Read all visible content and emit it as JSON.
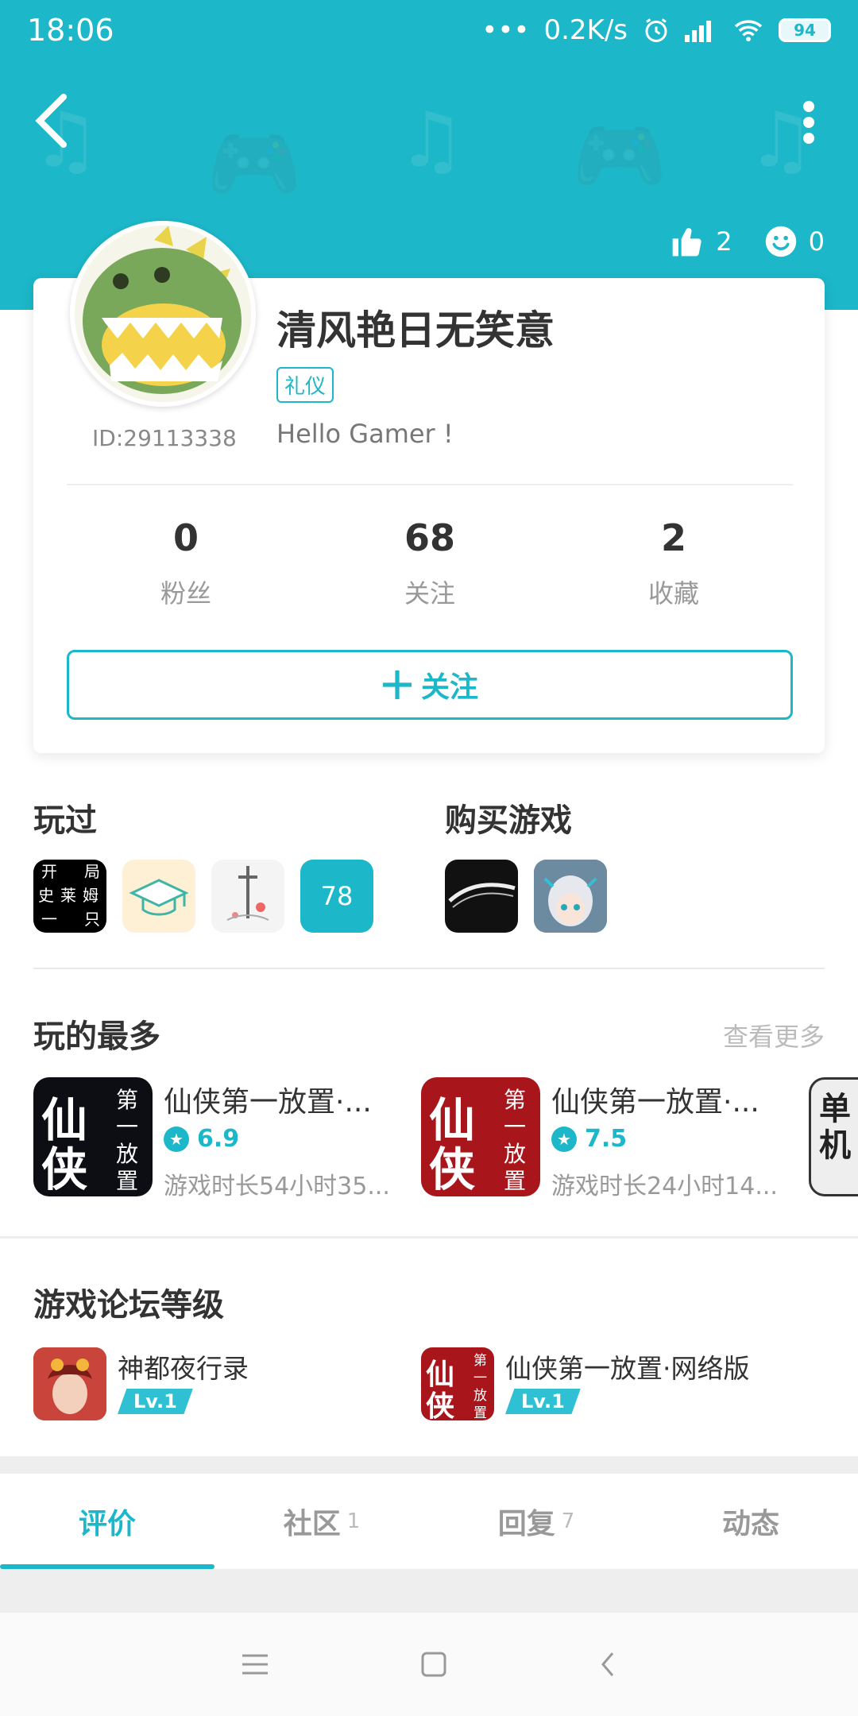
{
  "status_bar": {
    "time": "18:06",
    "dots": "•••",
    "speed": "0.2K/s",
    "battery": "94",
    "icons": [
      "alarm-icon",
      "signal-icon",
      "wifi-icon",
      "battery-icon"
    ]
  },
  "header": {
    "likes": "2",
    "smiles": "0",
    "icons": [
      "back-arrow-icon",
      "more-vertical-icon",
      "thumbs-up-icon",
      "smiley-icon"
    ]
  },
  "profile": {
    "name": "清风艳日无笑意",
    "badge": "礼仪",
    "id": "ID:29113338",
    "motto": "Hello Gamer !",
    "counts": [
      {
        "value": "0",
        "label": "粉丝"
      },
      {
        "value": "68",
        "label": "关注"
      },
      {
        "value": "2",
        "label": "收藏"
      }
    ],
    "follow_label": "关注"
  },
  "played": {
    "title": "玩过",
    "icon1_text": [
      "开",
      "局",
      "史",
      "莱",
      "姆",
      "一",
      "只"
    ],
    "more_count": "78"
  },
  "purchased": {
    "title": "购买游戏"
  },
  "most_played": {
    "title": "玩的最多",
    "see_more": "查看更多",
    "items": [
      {
        "name": "仙侠第一放置·...",
        "score": "6.9",
        "time": "游戏时长54小时35...",
        "icon_chars": [
          "仙",
          "侠",
          "第",
          "一",
          "放",
          "置"
        ]
      },
      {
        "name": "仙侠第一放置·...",
        "score": "7.5",
        "time": "游戏时长24小时14...",
        "icon_chars": [
          "仙",
          "侠",
          "第",
          "一",
          "放",
          "置"
        ]
      },
      {
        "icon_chars": [
          "单",
          "机"
        ]
      }
    ]
  },
  "forum_levels": {
    "title": "游戏论坛等级",
    "items": [
      {
        "name": "神都夜行录",
        "level": "Lv.1"
      },
      {
        "name": "仙侠第一放置·网络版",
        "level": "Lv.1",
        "icon_chars": [
          "仙",
          "侠",
          "第",
          "一",
          "放",
          "置"
        ]
      }
    ]
  },
  "tabs": [
    {
      "label": "评价",
      "count": "",
      "active": true
    },
    {
      "label": "社区",
      "count": "1"
    },
    {
      "label": "回复",
      "count": "7"
    },
    {
      "label": "动态",
      "count": ""
    }
  ],
  "colors": {
    "accent": "#1cb7c9",
    "badge": "#2fc1d3"
  },
  "system_nav": [
    "menu-icon",
    "home-icon",
    "back-icon"
  ]
}
